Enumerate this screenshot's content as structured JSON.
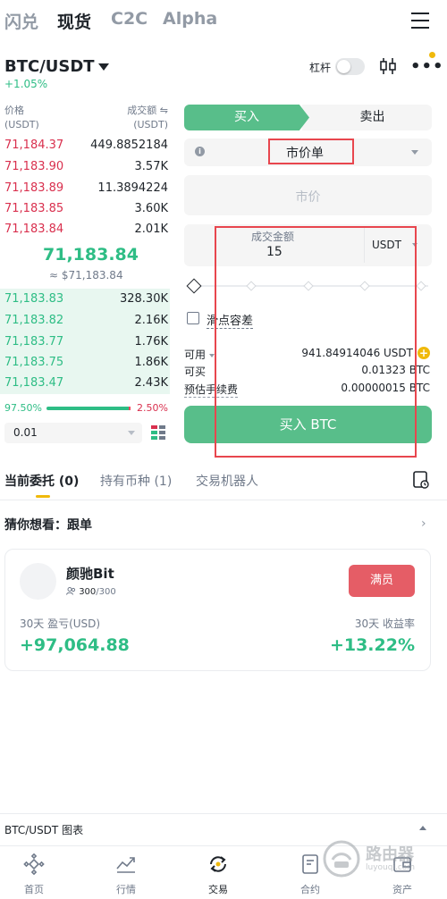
{
  "top_tabs": [
    "闪兑",
    "现货",
    "C2C",
    "Alpha"
  ],
  "pair": {
    "symbol": "BTC/USDT",
    "change": "+1.05%",
    "leverage_label": "杠杆"
  },
  "order_book": {
    "price_header": [
      "价格",
      "(USDT)"
    ],
    "amount_header": [
      "成交额 ⇋",
      "(USDT)"
    ],
    "asks": [
      {
        "price": "71,184.37",
        "amount": "449.8852184"
      },
      {
        "price": "71,183.90",
        "amount": "3.57K"
      },
      {
        "price": "71,183.89",
        "amount": "11.3894224"
      },
      {
        "price": "71,183.85",
        "amount": "3.60K"
      },
      {
        "price": "71,183.84",
        "amount": "2.01K"
      }
    ],
    "mid_price": "71,183.84",
    "mid_sub": "≈ $71,183.84",
    "bids": [
      {
        "price": "71,183.83",
        "amount": "328.30K"
      },
      {
        "price": "71,183.82",
        "amount": "2.16K"
      },
      {
        "price": "71,183.77",
        "amount": "1.76K"
      },
      {
        "price": "71,183.75",
        "amount": "1.86K"
      },
      {
        "price": "71,183.47",
        "amount": "2.43K"
      }
    ],
    "buy_ratio": "97.50%",
    "sell_ratio": "2.50%",
    "buy_ratio_value": 0.975,
    "depth": "0.01"
  },
  "trade": {
    "buy_tab": "买入",
    "sell_tab": "卖出",
    "order_type": "市价单",
    "price_placeholder": "市价",
    "amount_label": "成交金额",
    "amount_value": "15",
    "unit": "USDT",
    "slippage_label": "滑点容差",
    "available_label": "可用",
    "available_value": "941.84914046 USDT",
    "can_buy_label": "可买",
    "can_buy_value": "0.01323 BTC",
    "fee_label": "预估手续费",
    "fee_value": "0.00000015 BTC",
    "buy_button": "买入 BTC"
  },
  "orders_tabs": [
    "当前委托 (0)",
    "持有币种 (1)",
    "交易机器人"
  ],
  "guess": {
    "title": "猜你想看：跟单"
  },
  "copy_card": {
    "name": "颜驰Bit",
    "members_current": "300",
    "members_total": "/300",
    "button": "满员",
    "pnl_label": "30天 盈亏(USD)",
    "pnl_value": "+97,064.88",
    "roi_label": "30天 收益率",
    "roi_value": "+13.22%"
  },
  "chart_bar": {
    "label": "BTC/USDT 图表"
  },
  "bottom_nav": [
    "首页",
    "行情",
    "交易",
    "合约",
    "资产"
  ],
  "watermark": {
    "title": "路由器",
    "subtitle": "luyouqi.com"
  },
  "colors": {
    "green": "#2ebd85",
    "red": "#d9304e",
    "yellow": "#f0b90b",
    "annotation": "#e8464e"
  }
}
